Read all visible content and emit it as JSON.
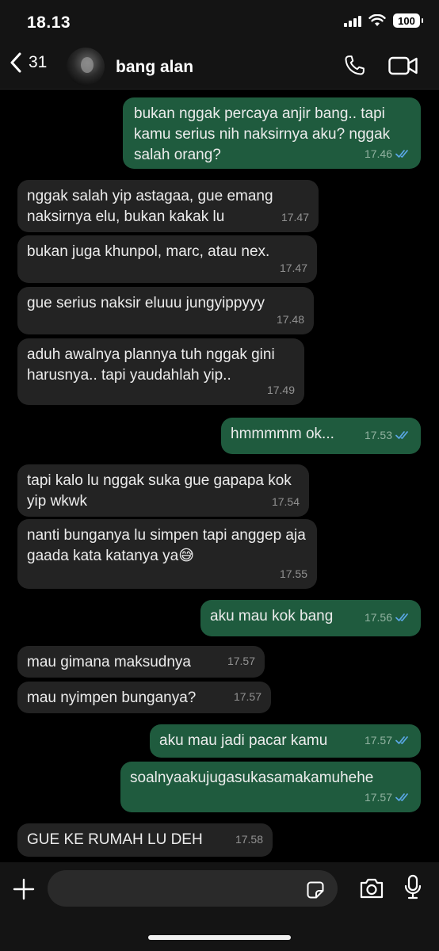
{
  "status_bar": {
    "time": "18.13",
    "battery": "100"
  },
  "header": {
    "back_count": "31",
    "contact_name": "bang alan"
  },
  "messages": [
    {
      "dir": "out",
      "text": "bukan nggak percaya anjir bang.. tapi kamu serius nih naksirnya aku? nggak salah orang?",
      "time": "17.46",
      "read": true
    },
    {
      "dir": "in",
      "text": "nggak salah yip astagaa, gue emang naksirnya elu, bukan kakak lu",
      "time": "17.47"
    },
    {
      "dir": "in",
      "text": "bukan juga khunpol, marc, atau nex.",
      "time": "17.47"
    },
    {
      "dir": "in",
      "text": "gue serius naksir eluuu jungyippyyy",
      "time": "17.48"
    },
    {
      "dir": "in",
      "text": "aduh awalnya plannya tuh nggak gini harusnya.. tapi yaudahlah yip..",
      "time": "17.49"
    },
    {
      "dir": "out",
      "text": "hmmmmm ok...",
      "time": "17.53",
      "read": true
    },
    {
      "dir": "in",
      "text": "tapi kalo lu nggak suka gue gapapa kok yip wkwk",
      "time": "17.54"
    },
    {
      "dir": "in",
      "text": "nanti bunganya lu simpen tapi anggep aja gaada kata katanya ya😅",
      "time": "17.55"
    },
    {
      "dir": "out",
      "text": "aku mau kok bang",
      "time": "17.56",
      "read": true
    },
    {
      "dir": "in",
      "text": "mau gimana maksudnya",
      "time": "17.57"
    },
    {
      "dir": "in",
      "text": "mau nyimpen bunganya?",
      "time": "17.57"
    },
    {
      "dir": "out",
      "text": "aku mau jadi pacar kamu",
      "time": "17.57",
      "read": true
    },
    {
      "dir": "out",
      "text": "soalnyaakujugasukasamakamuhehe",
      "time": "17.57",
      "read": true
    },
    {
      "dir": "in",
      "text": "GUE KE RUMAH LU DEH",
      "time": "17.58"
    }
  ],
  "composer": {
    "placeholder": ""
  },
  "colors": {
    "incoming": "#232323",
    "outgoing": "#1f5b3e",
    "read_ticks": "#5aa7e6"
  },
  "icons": [
    "back-chevron-icon",
    "phone-icon",
    "video-icon",
    "plus-icon",
    "sticker-icon",
    "camera-icon",
    "mic-icon"
  ]
}
